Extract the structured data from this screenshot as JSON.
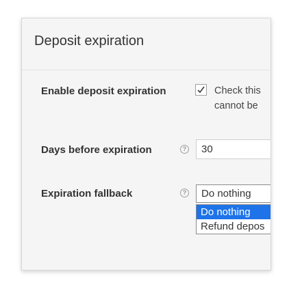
{
  "panel": {
    "title": "Deposit expiration"
  },
  "fields": {
    "enable": {
      "label": "Enable deposit expiration",
      "checked": true,
      "description_line1": "Check this",
      "description_line2": "cannot be"
    },
    "days": {
      "label": "Days before expiration",
      "help_icon": "help-icon",
      "value": "30"
    },
    "fallback": {
      "label": "Expiration fallback",
      "help_icon": "help-icon",
      "selected": "Do nothing",
      "options": [
        "Do nothing",
        "Refund depos"
      ]
    }
  },
  "colors": {
    "selection": "#1e73e8",
    "panel_bg": "#f5f5f5"
  }
}
